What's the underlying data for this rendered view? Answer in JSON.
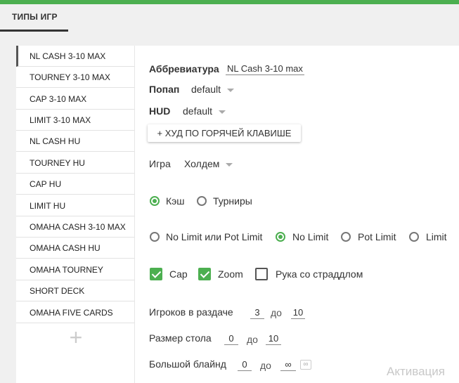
{
  "header": {
    "tab_label": "ТИПЫ ИГР"
  },
  "sidebar": {
    "items": [
      {
        "label": "NL CASH 3-10 MAX"
      },
      {
        "label": "TOURNEY 3-10 MAX"
      },
      {
        "label": "CAP 3-10 MAX"
      },
      {
        "label": "LIMIT 3-10 MAX"
      },
      {
        "label": "NL CASH HU"
      },
      {
        "label": "TOURNEY HU"
      },
      {
        "label": "CAP HU"
      },
      {
        "label": "LIMIT HU"
      },
      {
        "label": "OMAHA CASH 3-10 MAX"
      },
      {
        "label": "OMAHA CASH HU"
      },
      {
        "label": "OMAHA TOURNEY"
      },
      {
        "label": "SHORT DECK"
      },
      {
        "label": "OMAHA FIVE CARDS"
      }
    ],
    "add_symbol": "+"
  },
  "form": {
    "abbr_label": "Аббревиатура",
    "abbr_value": "NL Cash 3-10 max",
    "popup_label": "Попап",
    "popup_value": "default",
    "hud_label": "HUD",
    "hud_value": "default",
    "hotkey_button": "+ ХУД ПО ГОРЯЧЕЙ КЛАВИШЕ",
    "game_label": "Игра",
    "game_value": "Холдем",
    "type_options": [
      {
        "label": "Кэш",
        "selected": true
      },
      {
        "label": "Турниры",
        "selected": false
      }
    ],
    "limit_options": [
      {
        "label": "No Limit или Pot Limit",
        "selected": false
      },
      {
        "label": "No Limit",
        "selected": true
      },
      {
        "label": "Pot Limit",
        "selected": false
      },
      {
        "label": "Limit",
        "selected": false
      }
    ],
    "checkboxes": [
      {
        "label": "Cap",
        "checked": true
      },
      {
        "label": "Zoom",
        "checked": true
      },
      {
        "label": "Рука со страддлом",
        "checked": false
      }
    ],
    "players_label": "Игроков в раздаче",
    "players_from": "3",
    "players_to": "10",
    "table_size_label": "Размер стола",
    "table_from": "0",
    "table_to": "10",
    "big_blind_label": "Большой блайнд",
    "bb_from": "0",
    "bb_to": "∞",
    "infinity_icon_text": "∞",
    "to_word": "до"
  },
  "watermark": "Активация",
  "colors": {
    "accent": "#4caf50"
  }
}
